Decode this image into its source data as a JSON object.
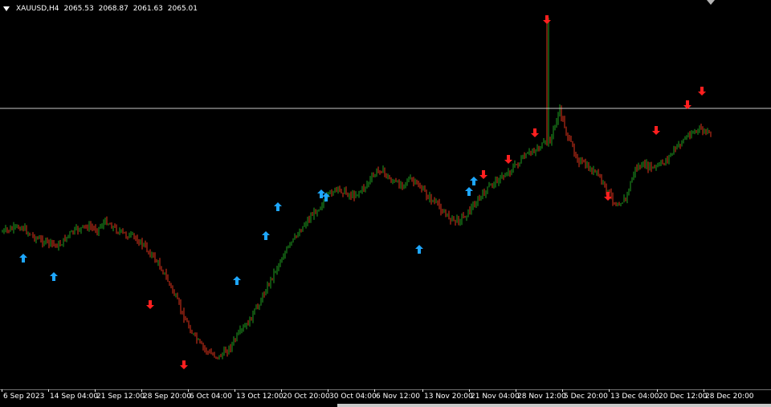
{
  "header": {
    "symbol": "XAUUSD,H4",
    "open": "2065.53",
    "high": "2068.87",
    "low": "2061.63",
    "close": "2065.01"
  },
  "colors": {
    "background": "#000000",
    "bull": "#1f9e1f",
    "bear": "#e0341c",
    "buy_arrow": "#1ea7ff",
    "sell_arrow": "#ff1f1f",
    "hline": "#c8c8c8",
    "text": "#ffffff"
  },
  "time_axis": {
    "labels": [
      "6 Sep 2023",
      "14 Sep 04:00",
      "21 Sep 12:00",
      "28 Sep 20:00",
      "6 Oct 04:00",
      "13 Oct 12:00",
      "20 Oct 20:00",
      "30 Oct 04:00",
      "6 Nov 12:00",
      "13 Nov 20:00",
      "21 Nov 04:00",
      "28 Nov 12:00",
      "5 Dec 20:00",
      "13 Dec 04:00",
      "20 Dec 12:00",
      "28 Dec 20:00"
    ]
  },
  "chart_data": {
    "type": "candlestick",
    "symbol": "XAUUSD",
    "timeframe": "H4",
    "x_start": "6 Sep 2023",
    "x_end": "28 Dec 20:00",
    "price_path": [
      0.51,
      0.52,
      0.53,
      0.5,
      0.48,
      0.47,
      0.46,
      0.5,
      0.52,
      0.53,
      0.52,
      0.55,
      0.52,
      0.5,
      0.49,
      0.46,
      0.42,
      0.37,
      0.3,
      0.22,
      0.15,
      0.1,
      0.07,
      0.06,
      0.09,
      0.14,
      0.18,
      0.24,
      0.31,
      0.38,
      0.44,
      0.49,
      0.54,
      0.58,
      0.62,
      0.66,
      0.66,
      0.64,
      0.66,
      0.7,
      0.74,
      0.7,
      0.68,
      0.7,
      0.68,
      0.64,
      0.61,
      0.57,
      0.55,
      0.57,
      0.61,
      0.65,
      0.69,
      0.71,
      0.74,
      0.77,
      0.8,
      0.82,
      0.84,
      0.95,
      0.84,
      0.77,
      0.74,
      0.72,
      0.66,
      0.61,
      0.63,
      0.74,
      0.75,
      0.74,
      0.76,
      0.8,
      0.84,
      0.87,
      0.88,
      0.86
    ],
    "spike": {
      "time": "28 Nov 12:00",
      "direction": "up"
    },
    "buy_signals": 11,
    "sell_signals": 10,
    "horizontal_line": "current price level",
    "grid": false
  }
}
